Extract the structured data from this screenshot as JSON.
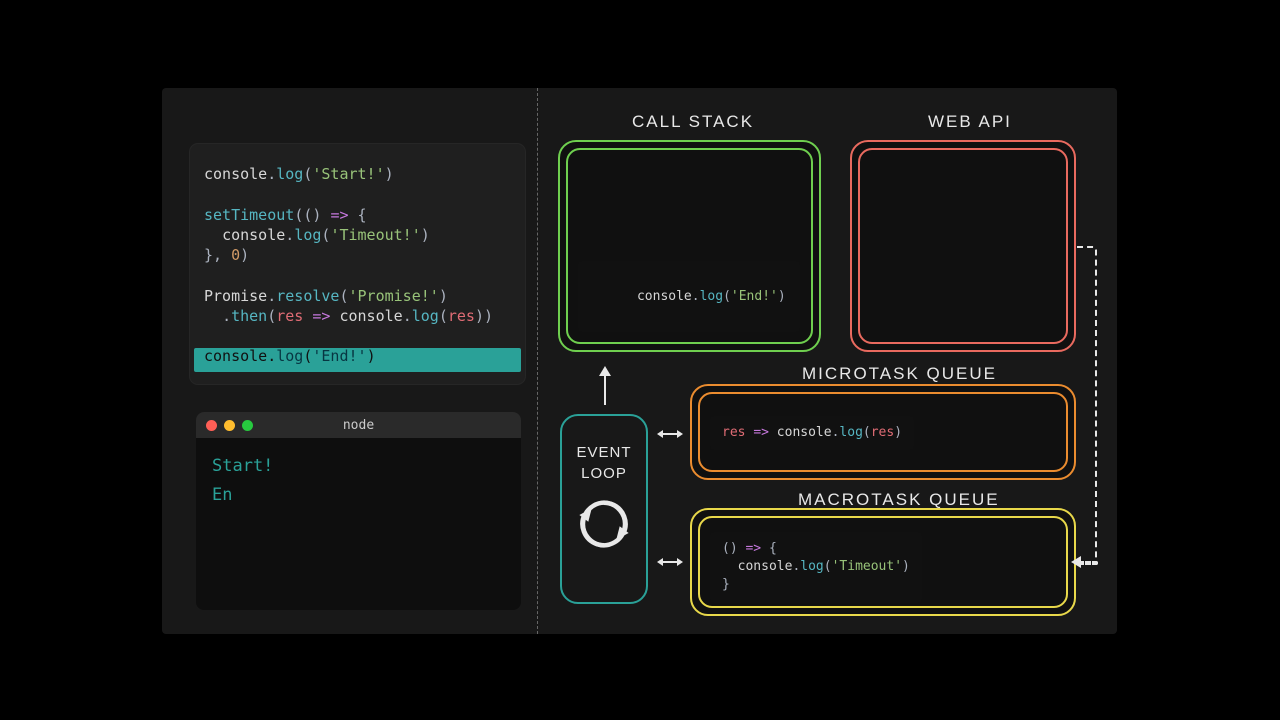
{
  "labels": {
    "call_stack": "CALL STACK",
    "web_api": "WEB API",
    "microtask_queue": "MICROTASK QUEUE",
    "macrotask_queue": "MACROTASK QUEUE",
    "event_loop_l1": "EVENT",
    "event_loop_l2": "LOOP"
  },
  "code": {
    "l1": "console.log('Start!')",
    "l2": "",
    "l3": "setTimeout(() => {",
    "l4": "  console.log('Timeout!')",
    "l5": "}, 0)",
    "l6": "",
    "l7": "Promise.resolve('Promise!')",
    "l8": "  .then(res => console.log(res))",
    "l9": "",
    "l10": "console.log('End!')",
    "highlight_line": 10
  },
  "terminal": {
    "title": "node",
    "lines": [
      "Start!",
      "En"
    ]
  },
  "call_stack_items": [
    "console.log('End!')"
  ],
  "web_api_items": [],
  "microtask_items": [
    "res => console.log(res)"
  ],
  "macrotask_items": [
    "() => {\n  console.log('Timeout')\n}"
  ]
}
